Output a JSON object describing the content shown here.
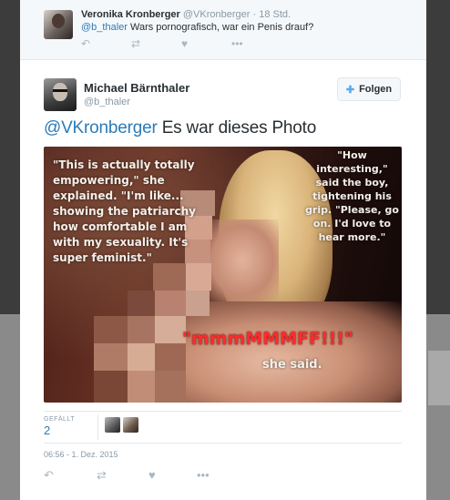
{
  "ancestor_tweet": {
    "name": "Veronika Kronberger",
    "handle": "@VKronberger",
    "time": "· 18 Std.",
    "mention": "@b_thaler",
    "text": " Wars pornografisch, war ein Penis drauf?",
    "actions": [
      "reply-icon",
      "retweet-icon",
      "like-icon",
      "more-icon"
    ]
  },
  "main_tweet": {
    "name": "Michael Bärnthaler",
    "handle": "@b_thaler",
    "follow_label": "Folgen",
    "mention": "@VKronberger",
    "text": " Es war dieses Photo",
    "photo": {
      "caption_left": "\"This is actually totally empowering,\" she explained. \"I'm like... showing the patriarchy how comfortable I am with my sexuality. It's super feminist.\"",
      "caption_right": "\"How interesting,\" said the boy, tightening his grip. \"Please, go on. I'd love to hear more.\"",
      "caption_red": "\"mmmMMMFF!!!\"",
      "caption_said": "she said."
    },
    "likes_label": "GEFÄLLT",
    "likes_count": "2",
    "timestamp": "06:56 - 1. Dez. 2015",
    "actions": [
      "reply-icon",
      "retweet-icon",
      "like-icon",
      "more-icon"
    ]
  },
  "colors": {
    "link": "#2b7bb9",
    "muted": "#8899a6",
    "follow_icon": "#55acee",
    "caption_red": "#ff2b2b"
  }
}
